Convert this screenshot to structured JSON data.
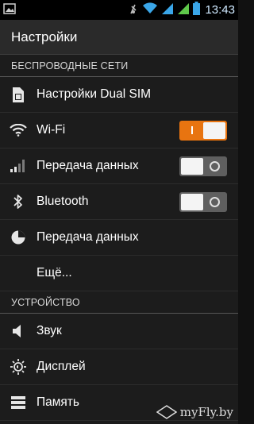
{
  "status_bar": {
    "time": "13:43",
    "icons": [
      "image-notification-icon",
      "mute-icon",
      "wifi-icon",
      "signal-sim1-icon",
      "signal-sim2-icon",
      "battery-icon"
    ]
  },
  "action_bar": {
    "title": "Настройки"
  },
  "sections": [
    {
      "header": "БЕСПРОВОДНЫЕ СЕТИ",
      "items": [
        {
          "label": "Настройки Dual SIM",
          "icon": "sim-card-icon"
        },
        {
          "label": "Wi-Fi",
          "icon": "wifi-icon",
          "toggle": "on"
        },
        {
          "label": "Передача данных",
          "icon": "signal-bars-icon",
          "toggle": "off"
        },
        {
          "label": "Bluetooth",
          "icon": "bluetooth-icon",
          "toggle": "off"
        },
        {
          "label": "Передача данных",
          "icon": "data-usage-icon"
        },
        {
          "label": "Ещё...",
          "icon": ""
        }
      ]
    },
    {
      "header": "УСТРОЙСТВО",
      "items": [
        {
          "label": "Звук",
          "icon": "sound-icon"
        },
        {
          "label": "Дисплей",
          "icon": "brightness-icon"
        },
        {
          "label": "Память",
          "icon": "storage-icon"
        }
      ]
    }
  ],
  "watermark": "myFly.by",
  "colors": {
    "toggle_on": "#e87410",
    "toggle_off": "#5f5f5f",
    "background": "#1c1c1c",
    "action_bar": "#2a2a2a"
  }
}
